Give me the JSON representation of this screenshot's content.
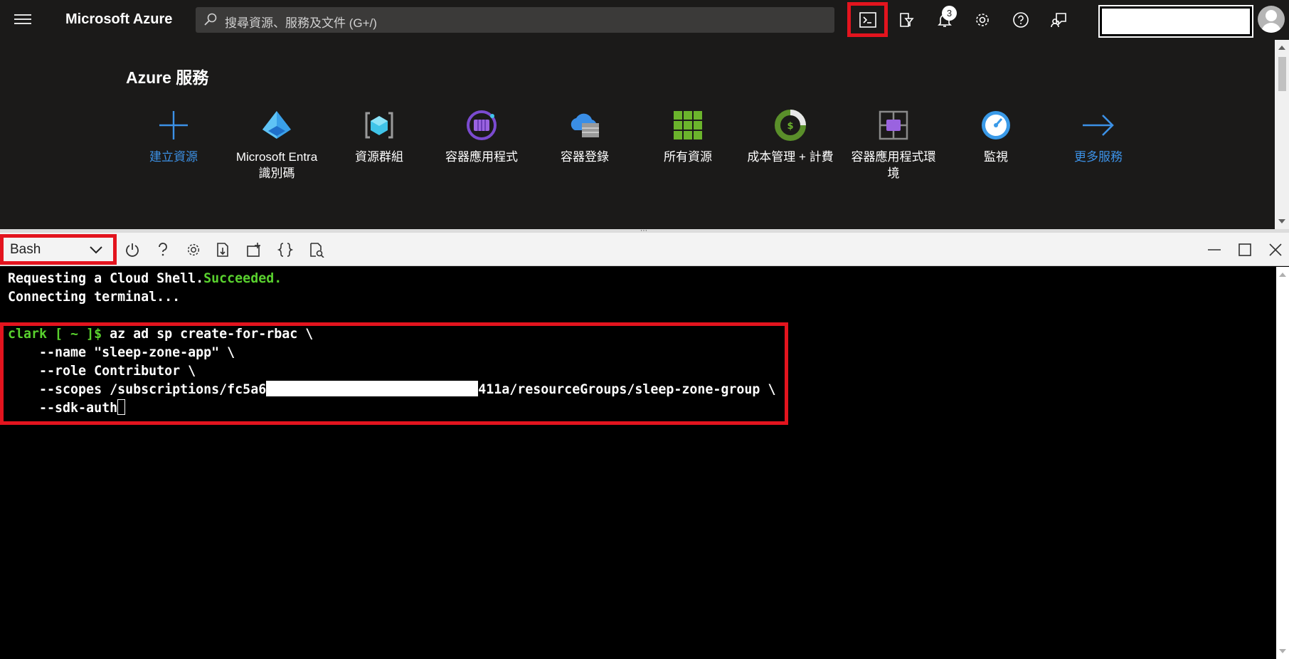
{
  "topbar": {
    "brand": "Microsoft Azure",
    "search_placeholder": "搜尋資源、服務及文件 (G+/)",
    "notification_count": "3"
  },
  "services": {
    "title": "Azure 服務",
    "items": [
      {
        "label": "建立資源",
        "icon": "plus-icon"
      },
      {
        "label": "Microsoft Entra 識別碼",
        "icon": "entra-id-icon"
      },
      {
        "label": "資源群組",
        "icon": "resource-group-icon"
      },
      {
        "label": "容器應用程式",
        "icon": "container-apps-icon"
      },
      {
        "label": "容器登錄",
        "icon": "container-registry-icon"
      },
      {
        "label": "所有資源",
        "icon": "all-resources-icon"
      },
      {
        "label": "成本管理 + 計費",
        "icon": "cost-management-icon"
      },
      {
        "label": "容器應用程式環境",
        "icon": "container-app-env-icon"
      },
      {
        "label": "監視",
        "icon": "monitor-icon"
      },
      {
        "label": "更多服務",
        "icon": "arrow-right-icon"
      }
    ]
  },
  "shell": {
    "selected_shell": "Bash"
  },
  "terminal": {
    "line1_a": "Requesting a Cloud Shell.",
    "line1_b": "Succeeded.",
    "line2": "Connecting terminal...",
    "prompt": "clark [ ~ ]$",
    "cmd1": " az ad sp create-for-rbac \\",
    "cmd2": "    --name \"sleep-zone-app\" \\",
    "cmd3": "    --role Contributor \\",
    "cmd4_a": "    --scopes /subscriptions/fc5a6",
    "cmd4_b": "411a/resourceGroups/sleep-zone-group \\",
    "cmd5": "    --sdk-auth"
  },
  "colors": {
    "highlight_red": "#e3141e",
    "terminal_green": "#59d12e",
    "link_blue": "#3c91e6",
    "topbar_bg": "#1b1a19"
  }
}
